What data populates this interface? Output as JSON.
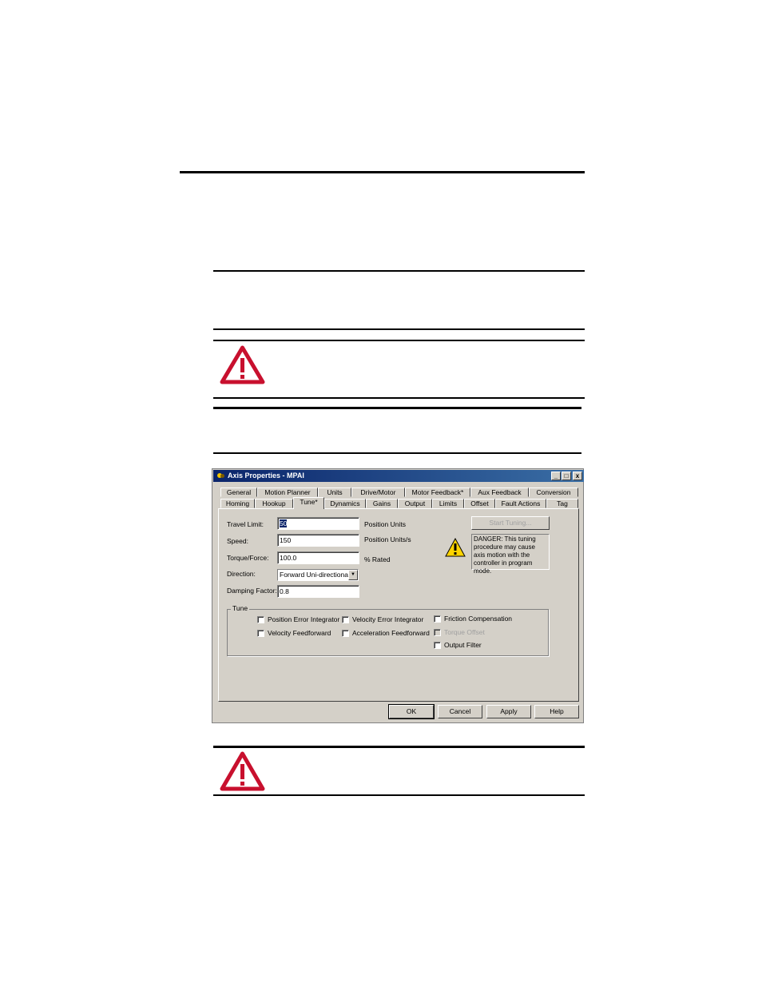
{
  "dialog": {
    "title": "Axis Properties - MPAI",
    "window_buttons": {
      "minimize": "_",
      "maximize": "□",
      "close": "x"
    },
    "tabs_row1": [
      "General",
      "Motion Planner",
      "Units",
      "Drive/Motor",
      "Motor Feedback*",
      "Aux Feedback",
      "Conversion"
    ],
    "tabs_row2": [
      "Homing",
      "Hookup",
      "Tune*",
      "Dynamics",
      "Gains",
      "Output",
      "Limits",
      "Offset",
      "Fault Actions",
      "Tag"
    ],
    "active_tab": "Tune*",
    "fields": {
      "travel_limit": {
        "label": "Travel Limit:",
        "value": "50",
        "unit": "Position Units"
      },
      "speed": {
        "label": "Speed:",
        "value": "150",
        "unit": "Position Units/s"
      },
      "torque_force": {
        "label": "Torque/Force:",
        "value": "100.0",
        "unit": "% Rated"
      },
      "direction": {
        "label": "Direction:",
        "value": "Forward Uni-directional"
      },
      "damping_factor": {
        "label": "Damping Factor:",
        "value": "0.8"
      }
    },
    "start_tuning_label": "Start Tuning...",
    "danger_message": "DANGER: This tuning procedure may cause axis motion with the controller in program mode.",
    "tune_group": {
      "title": "Tune",
      "options": {
        "position_error_integrator": "Position Error Integrator",
        "velocity_error_integrator": "Velocity Error Integrator",
        "friction_compensation": "Friction Compensation",
        "velocity_feedforward": "Velocity Feedforward",
        "acceleration_feedforward": "Acceleration Feedforward",
        "torque_offset": "Torque Offset",
        "output_filter": "Output Filter"
      }
    },
    "buttons": {
      "ok": "OK",
      "cancel": "Cancel",
      "apply": "Apply",
      "help": "Help"
    }
  },
  "colors": {
    "dialog_bg": "#d4d0c8",
    "titlebar_start": "#0a246a",
    "titlebar_end": "#3a6ea5",
    "warning_red": "#c8102e",
    "warning_yellow": "#ffd400"
  },
  "icons": {
    "page_warning": "warning-triangle-icon",
    "dialog_warning": "warning-icon",
    "app": "app-icon"
  }
}
